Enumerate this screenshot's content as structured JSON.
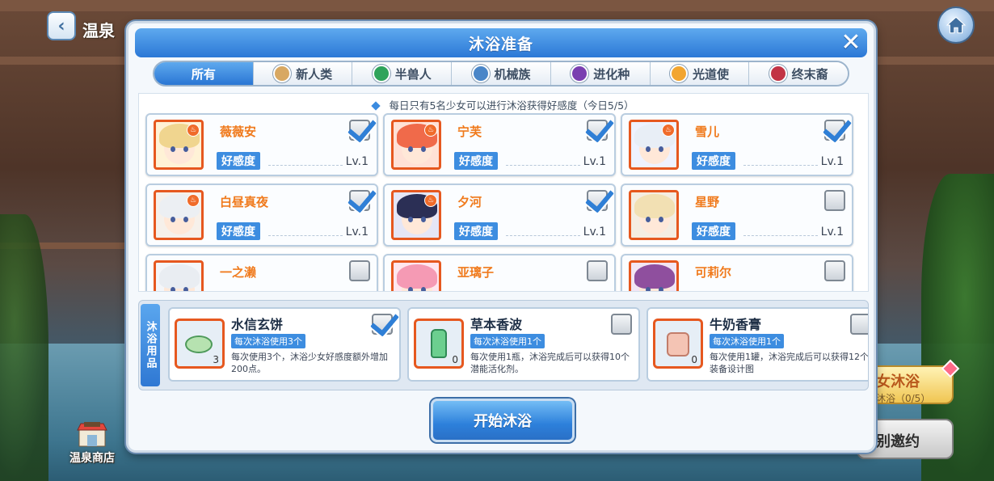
{
  "scene": {
    "title": "温泉",
    "shop_label": "温泉商店"
  },
  "side_buttons": {
    "bath_title": "女沐浴",
    "bath_sub": "沐浴（0/5）",
    "invite": "别邀约"
  },
  "dialog": {
    "title": "沐浴准备",
    "tabs": [
      {
        "label": "所有",
        "active": true,
        "icon": "",
        "color": ""
      },
      {
        "label": "新人类",
        "icon": "new-human-icon",
        "color": "#d8a862"
      },
      {
        "label": "半兽人",
        "icon": "half-beast-icon",
        "color": "#2fa35a"
      },
      {
        "label": "机械族",
        "icon": "mech-icon",
        "color": "#4a86c8"
      },
      {
        "label": "进化种",
        "icon": "evolved-icon",
        "color": "#7a3fb0"
      },
      {
        "label": "光道使",
        "icon": "light-icon",
        "color": "#f2a530"
      },
      {
        "label": "终末裔",
        "icon": "end-icon",
        "color": "#c23445"
      }
    ],
    "notice": "每日只有5名少女可以进行沐浴获得好感度（今日5/5）",
    "favor_label": "好感度",
    "characters": [
      {
        "name": "薇薇安",
        "level": "Lv.1",
        "checked": true,
        "hair": "#f0d58f",
        "bg": "#fff2d6"
      },
      {
        "name": "宁芙",
        "level": "Lv.1",
        "checked": true,
        "hair": "#f06a4a",
        "bg": "#ffe1d6"
      },
      {
        "name": "雪儿",
        "level": "Lv.1",
        "checked": true,
        "hair": "#e8eef6",
        "bg": "#eef2ff"
      },
      {
        "name": "白昼真夜",
        "level": "Lv.1",
        "checked": true,
        "hair": "#eceff3",
        "bg": "#f6f0ea"
      },
      {
        "name": "夕河",
        "level": "Lv.1",
        "checked": true,
        "hair": "#2b2f55",
        "bg": "#e5e6f6"
      },
      {
        "name": "星野",
        "level": "Lv.1",
        "checked": false,
        "hair": "#f2e0b3",
        "bg": "#f4ede2"
      },
      {
        "name": "一之濑",
        "level": "",
        "checked": false,
        "hair": "#e9edf2",
        "bg": "#f4f6f9"
      },
      {
        "name": "亚璃子",
        "level": "",
        "checked": false,
        "hair": "#f59ab4",
        "bg": "#ffe6ee"
      },
      {
        "name": "可莉尔",
        "level": "",
        "checked": false,
        "hair": "#8f4f9e",
        "bg": "#f2e6f4"
      }
    ],
    "items_label": "沐浴用品",
    "items": [
      {
        "name": "水信玄饼",
        "usage": "每次沐浴使用3个",
        "desc": "每次使用3个，沐浴少女好感度额外增加200点。",
        "qty": "3",
        "checked": true,
        "icon": "mochi-icon"
      },
      {
        "name": "草本香波",
        "usage": "每次沐浴使用1个",
        "desc": "每次使用1瓶，沐浴完成后可以获得10个潜能活化剂。",
        "qty": "0",
        "checked": false,
        "icon": "shampoo-bottle-icon"
      },
      {
        "name": "牛奶香膏",
        "usage": "每次沐浴使用1个",
        "desc": "每次使用1罐，沐浴完成后可以获得12个装备设计图",
        "qty": "0",
        "checked": false,
        "icon": "cream-jar-icon"
      }
    ],
    "start_button": "开始沐浴"
  }
}
